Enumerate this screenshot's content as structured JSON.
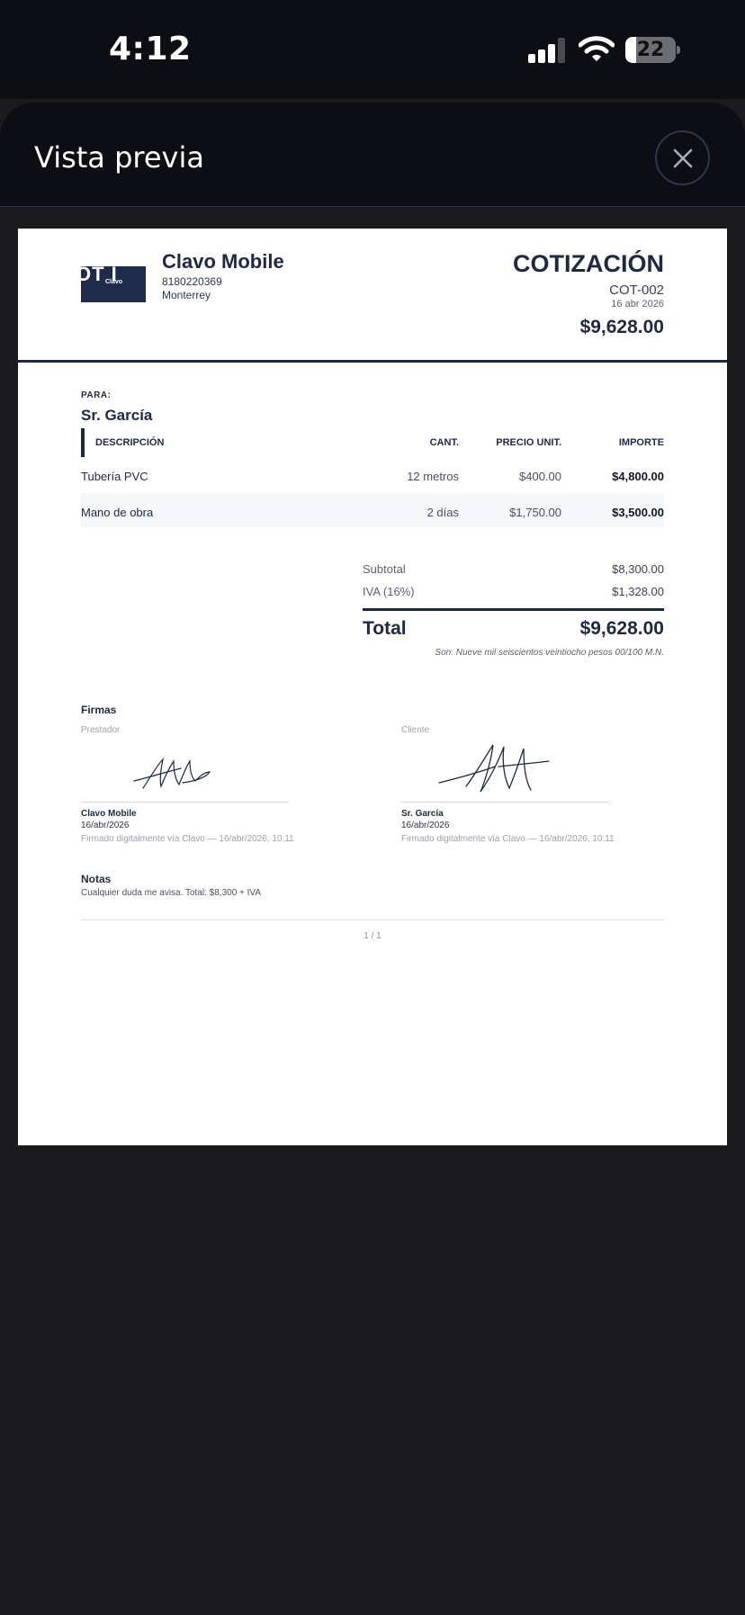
{
  "status_bar": {
    "time": "4:12",
    "battery_level": "22",
    "battery_fraction": 0.22
  },
  "sheet": {
    "title": "Vista previa",
    "close_icon": "close-icon"
  },
  "document": {
    "company": {
      "name": "Clavo Mobile",
      "phone": "8180220369",
      "city": "Monterrey"
    },
    "type": "COTIZACIÓN",
    "number": "COT-002",
    "date": "16 abr 2026",
    "total_top": "$9,628.00",
    "recipient_label": "PARA:",
    "recipient_name": "Sr. García",
    "table": {
      "headers": {
        "description": "DESCRIPCIÓN",
        "qty": "CANT.",
        "unit_price": "PRECIO UNIT.",
        "amount": "IMPORTE"
      },
      "rows": [
        {
          "description": "Tubería PVC",
          "qty": "12 metros",
          "unit_price": "$400.00",
          "amount": "$4,800.00"
        },
        {
          "description": "Mano de obra",
          "qty": "2 días",
          "unit_price": "$1,750.00",
          "amount": "$3,500.00"
        }
      ]
    },
    "summary": {
      "subtotal_label": "Subtotal",
      "subtotal_value": "$8,300.00",
      "tax_label": "IVA (16%)",
      "tax_value": "$1,328.00",
      "total_label": "Total",
      "total_value": "$9,628.00",
      "amount_words": "Son: Nueve mil seiscientos veintiocho pesos 00/100 M.N."
    },
    "signatures": {
      "title": "Firmas",
      "provider": {
        "role": "Prestador",
        "name": "Clavo Mobile",
        "date": "16/abr/2026",
        "note": "Firmado digitalmente vía Clavo — 16/abr/2026, 10:11"
      },
      "client": {
        "role": "Cliente",
        "name": "Sr. García",
        "date": "16/abr/2026",
        "note": "Firmado digitalmente vía Clavo — 16/abr/2026, 10:11"
      }
    },
    "notes": {
      "title": "Notas",
      "text": "Cualquier duda me avisa. Total: $8,300 + IVA"
    },
    "page": "1 / 1",
    "logo_text": {
      "big": "OT I",
      "small": "Clavo"
    }
  },
  "colors": {
    "navy": "#1e2a44",
    "background": "#1b1b1e",
    "header": "#0d0e13"
  }
}
